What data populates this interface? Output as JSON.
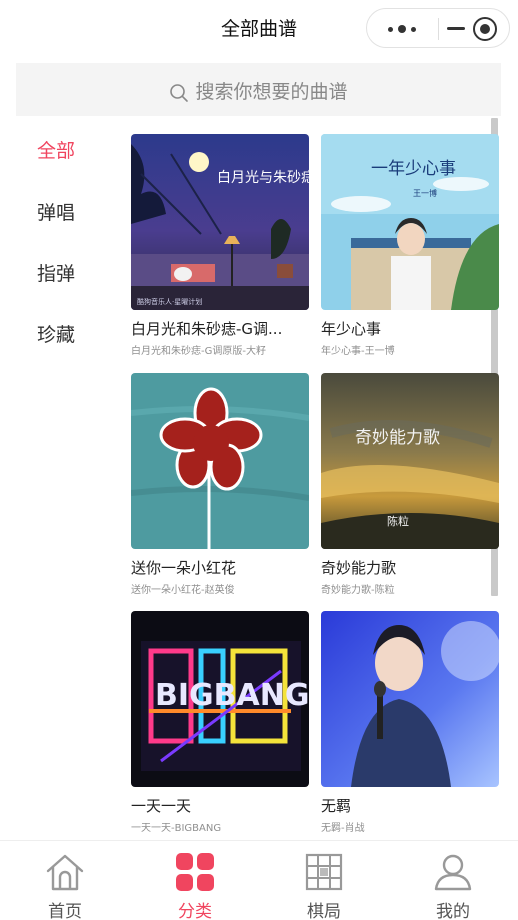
{
  "header": {
    "title": "全部曲谱"
  },
  "search": {
    "placeholder": "搜索你想要的曲谱"
  },
  "categories": [
    {
      "label": "全部",
      "active": true
    },
    {
      "label": "弹唱",
      "active": false
    },
    {
      "label": "指弹",
      "active": false
    },
    {
      "label": "珍藏",
      "active": false
    }
  ],
  "cards": [
    {
      "title": "白月光和朱砂痣-G调...",
      "subtitle": "白月光和朱砂痣-G调原版-大籽",
      "cover_text": "白月光与朱砂痣",
      "cover_caption": "酷狗音乐人·星曜计划"
    },
    {
      "title": "年少心事",
      "subtitle": "年少心事-王一博",
      "cover_text": "一年少心事",
      "cover_caption": "王一博"
    },
    {
      "title": "送你一朵小红花",
      "subtitle": "送你一朵小红花-赵英俊"
    },
    {
      "title": "奇妙能力歌",
      "subtitle": "奇妙能力歌-陈粒",
      "cover_text": "奇妙能力歌",
      "cover_caption": "陈粒"
    },
    {
      "title": "一天一天",
      "subtitle": "一天一天-BIGBANG",
      "cover_text": "BIGBANG"
    },
    {
      "title": "无羁",
      "subtitle": "无羁-肖战"
    }
  ],
  "tabbar": [
    {
      "label": "首页",
      "icon": "home-icon",
      "active": false
    },
    {
      "label": "分类",
      "icon": "category-grid-icon",
      "active": true
    },
    {
      "label": "棋局",
      "icon": "chessboard-icon",
      "active": false
    },
    {
      "label": "我的",
      "icon": "user-icon",
      "active": false
    }
  ],
  "colors": {
    "accent": "#f0455f",
    "search_bg": "#f4f4f4",
    "inactive_text": "#555555"
  }
}
